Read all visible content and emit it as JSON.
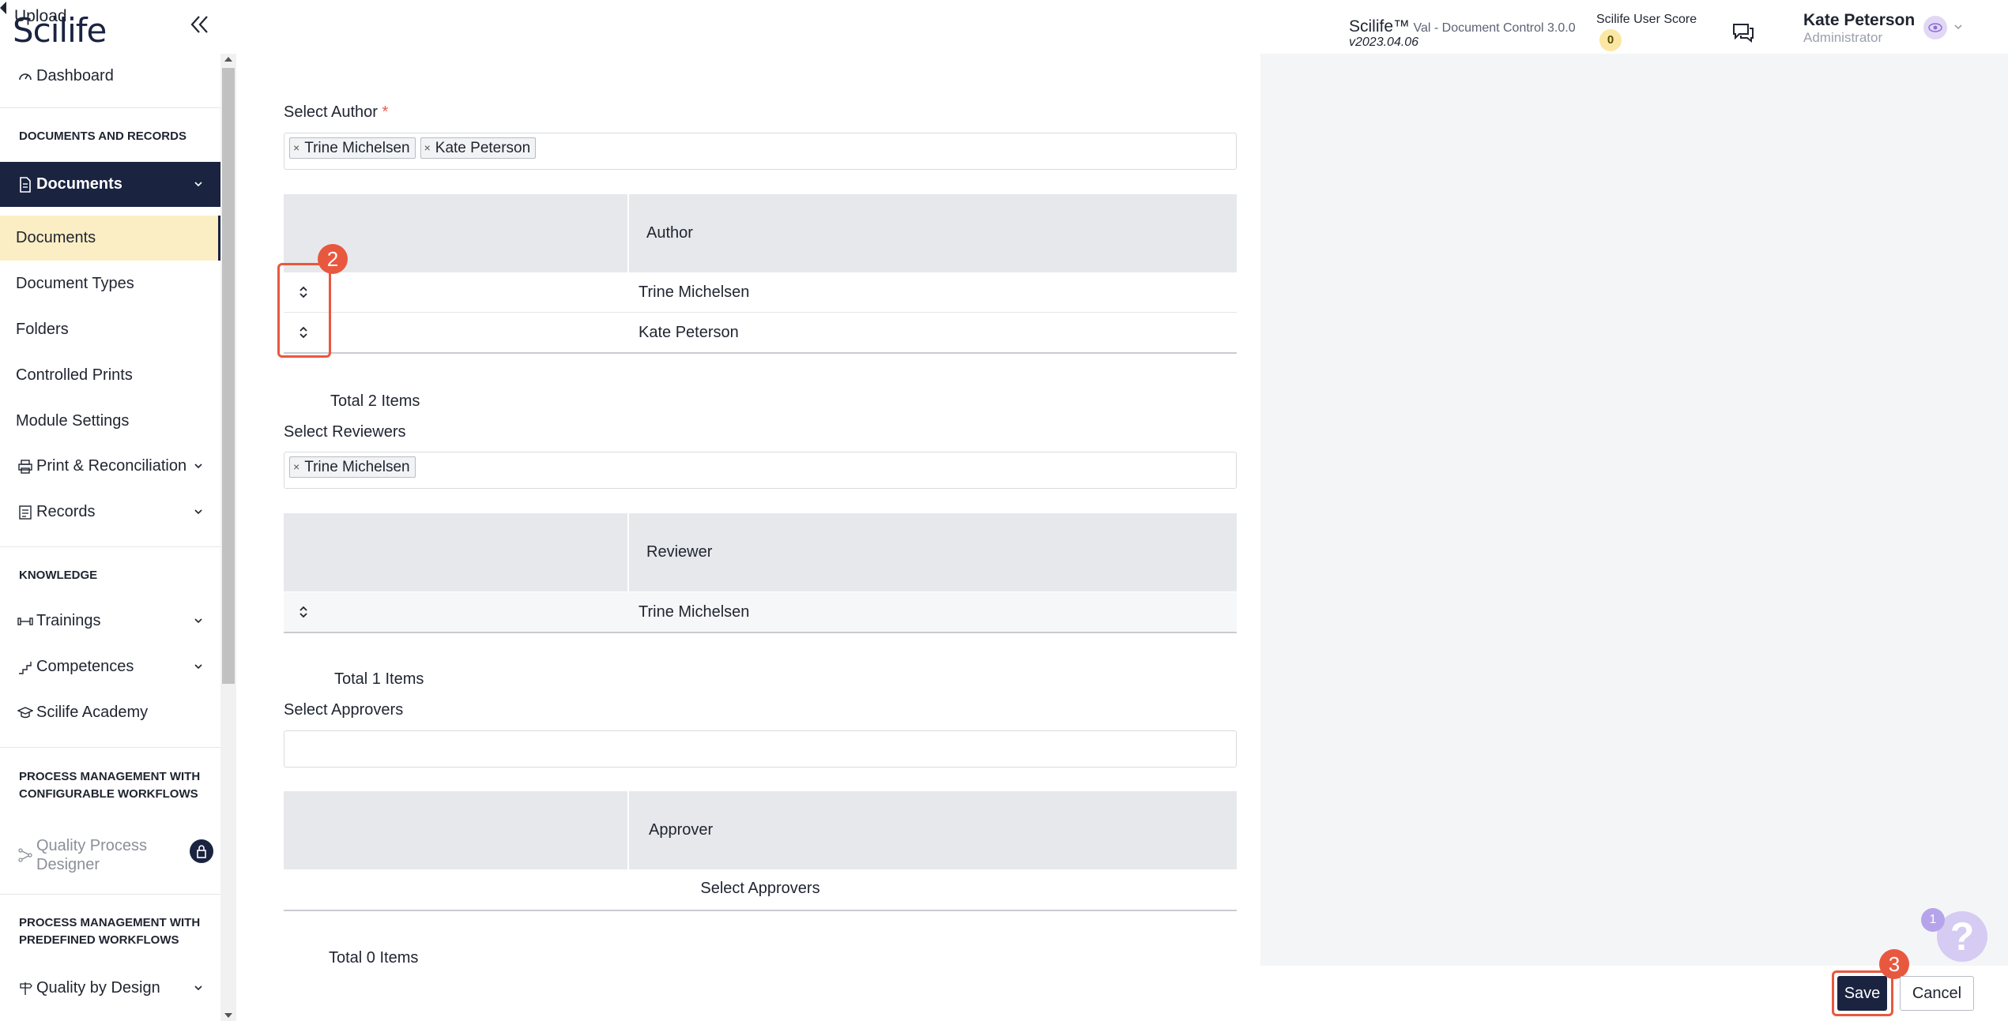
{
  "header": {
    "upload_label": "Upload",
    "logo_text": "Scilife",
    "app_name": "Scilife™",
    "app_subtitle": " Val - Document Control 3.0.0",
    "app_version": "v2023.04.06",
    "score_label": "Scilife User Score",
    "score_value": "0",
    "user_name": "Kate Peterson",
    "user_role": "Administrator"
  },
  "sidebar": {
    "dashboard": "Dashboard",
    "section_docs": "DOCUMENTS AND RECORDS",
    "documents": "Documents",
    "sub_items": [
      "Documents",
      "Document Types",
      "Folders",
      "Controlled Prints",
      "Module Settings"
    ],
    "print_reconciliation": "Print & Reconciliation",
    "records": "Records",
    "section_knowledge": "KNOWLEDGE",
    "trainings": "Trainings",
    "competences": "Competences",
    "academy": "Scilife Academy",
    "section_process_configurable": "PROCESS MANAGEMENT WITH CONFIGURABLE WORKFLOWS",
    "quality_process_designer": "Quality Process Designer",
    "section_process_predefined": "PROCESS MANAGEMENT WITH PREDEFINED WORKFLOWS",
    "quality_by_design": "Quality by Design"
  },
  "authors": {
    "label": "Select Author",
    "required_mark": "*",
    "tags": [
      "Trine Michelsen",
      "Kate Peterson"
    ],
    "column": "Author",
    "rows": [
      "Trine Michelsen",
      "Kate Peterson"
    ],
    "total": "Total 2 Items"
  },
  "reviewers": {
    "label": "Select Reviewers",
    "tags": [
      "Trine Michelsen"
    ],
    "column": "Reviewer",
    "rows": [
      "Trine Michelsen"
    ],
    "total": "Total 1 Items"
  },
  "approvers": {
    "label": "Select Approvers",
    "column": "Approver",
    "empty_text": "Select Approvers",
    "total": "Total 0 Items"
  },
  "callouts": {
    "step2": "2",
    "step3": "3"
  },
  "actions": {
    "save": "Save",
    "cancel": "Cancel"
  },
  "help": {
    "count": "1",
    "glyph": "?"
  },
  "colors": {
    "brand_dark": "#1a2340",
    "callout": "#e8583f",
    "active_child_bg": "#fbeec4"
  }
}
